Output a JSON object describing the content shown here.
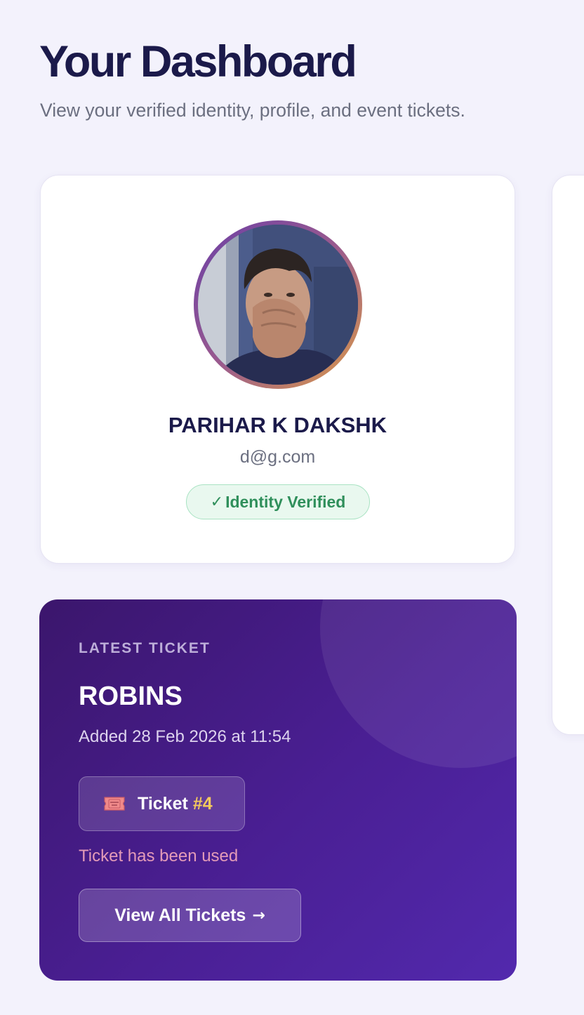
{
  "header": {
    "title": "Your Dashboard",
    "subtitle": "View your verified identity, profile, and event tickets."
  },
  "profile": {
    "name": "PARIHAR K DAKSHK",
    "email": "d@g.com",
    "verified_label": "Identity Verified",
    "verified_icon": "check-icon"
  },
  "latest_ticket": {
    "eyebrow": "LATEST TICKET",
    "event_name": "ROBINS",
    "added_text": "Added 28 Feb 2026 at 11:54",
    "ticket_label": "Ticket",
    "ticket_number": "#4",
    "ticket_icon": "admit-one-ticket-icon",
    "status_text": "Ticket has been used",
    "view_all_label": "View All Tickets",
    "view_all_icon": "arrow-right-icon"
  },
  "colors": {
    "page_bg": "#f3f2fc",
    "title": "#1b1a4a",
    "verified_green": "#2f8f5b",
    "ticket_gradient_start": "#3b166c",
    "ticket_gradient_end": "#5229ad",
    "ticket_number_gold": "#f4c95d",
    "status_pink": "#e39bb8"
  }
}
